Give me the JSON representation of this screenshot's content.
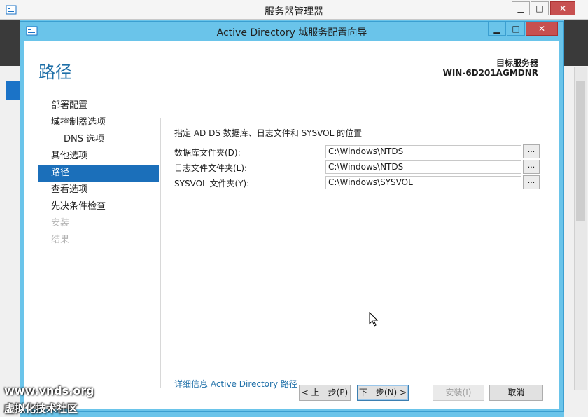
{
  "background_window": {
    "title": "服务器管理器",
    "min_label": "▁",
    "max_label": "□",
    "close_label": "✕"
  },
  "wizard": {
    "title": "Active Directory 域服务配置向导",
    "min_label": "▁",
    "max_label": "□",
    "close_label": "✕",
    "page_heading": "路径",
    "target_label": "目标服务器",
    "target_name": "WIN-6D201AGMDNR"
  },
  "nav": {
    "items": [
      {
        "label": "部署配置",
        "state": "normal"
      },
      {
        "label": "域控制器选项",
        "state": "normal"
      },
      {
        "label": "DNS 选项",
        "state": "sub"
      },
      {
        "label": "其他选项",
        "state": "normal"
      },
      {
        "label": "路径",
        "state": "active"
      },
      {
        "label": "查看选项",
        "state": "normal"
      },
      {
        "label": "先决条件检查",
        "state": "normal"
      },
      {
        "label": "安装",
        "state": "disabled"
      },
      {
        "label": "结果",
        "state": "disabled"
      }
    ]
  },
  "content": {
    "description": "指定 AD DS 数据库、日志文件和 SYSVOL 的位置",
    "rows": [
      {
        "label": "数据库文件夹(D):",
        "value": "C:\\Windows\\NTDS",
        "browse": "..."
      },
      {
        "label": "日志文件文件夹(L):",
        "value": "C:\\Windows\\NTDS",
        "browse": "..."
      },
      {
        "label": "SYSVOL 文件夹(Y):",
        "value": "C:\\Windows\\SYSVOL",
        "browse": "..."
      }
    ],
    "more_link": "详细信息 Active Directory 路径"
  },
  "buttons": {
    "prev": "< 上一步(P)",
    "next": "下一步(N) >",
    "install": "安装(I)",
    "cancel": "取消"
  },
  "watermark": {
    "line1": "www.vnds.org",
    "line2": "虚拟化技术社区"
  },
  "colors": {
    "accent": "#1b6fba",
    "frame": "#6ac4ea",
    "heading": "#1e6fa8",
    "close": "#c75050"
  }
}
